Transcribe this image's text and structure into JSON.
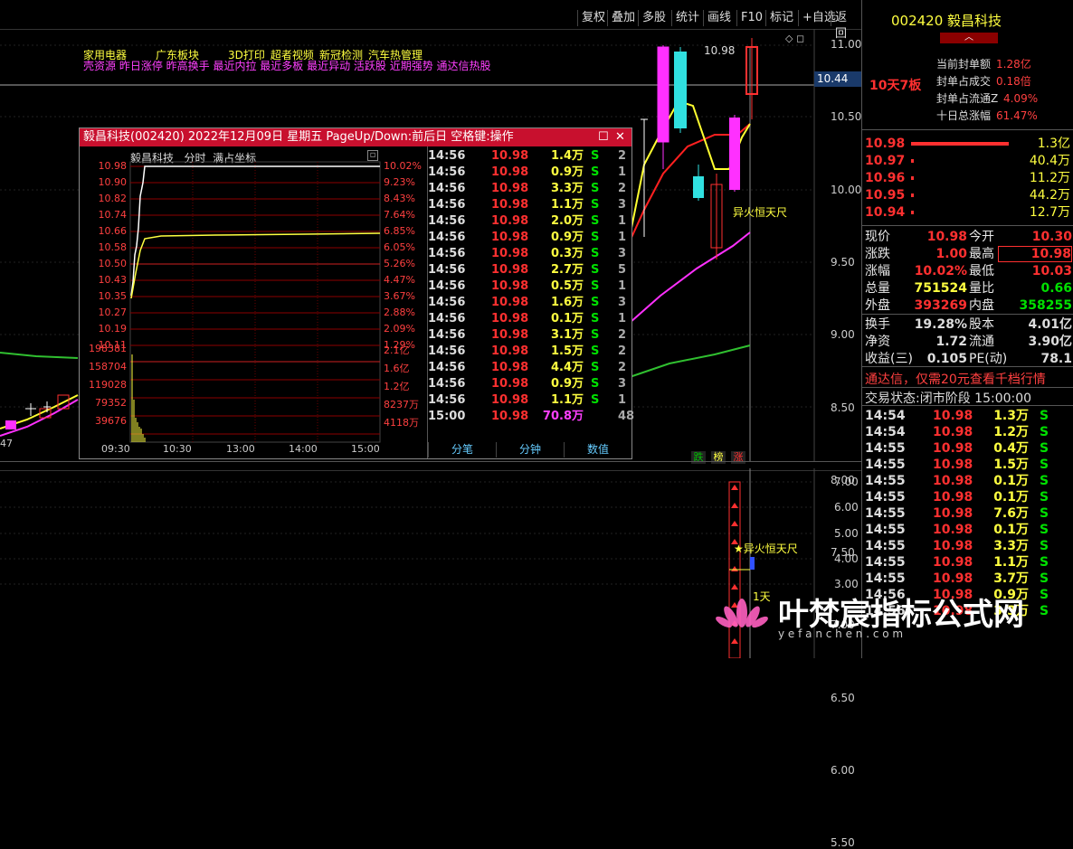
{
  "toolbar": {
    "buttons": [
      "复权",
      "叠加",
      "多股",
      "统计",
      "画线",
      "F10",
      "标记",
      "+自选",
      "返回"
    ]
  },
  "main_chart": {
    "concept_tags_1": [
      "家用电器",
      "广东板块",
      "3D打印",
      "超者视频",
      "新冠检测",
      "汽车热管理"
    ],
    "concept_tags_2": "壳资源 昨日涨停 昨高换手 最近内拉 最近多板 最近异动 活跃股 近期强势 通达信热股",
    "price_axis": [
      "11.00",
      "10.50",
      "10.00",
      "9.50",
      "9.00",
      "8.50",
      "8.00",
      "7.50",
      "7.00",
      "6.50",
      "6.00",
      "5.50"
    ],
    "current_price_label": "10.44",
    "high_label": "10.98",
    "annotation": "异火恒天尺",
    "left_label": "47",
    "bottom_badges": [
      "跌",
      "榜",
      "涨"
    ]
  },
  "indicator": {
    "axis": [
      "7.00",
      "6.00",
      "5.00",
      "4.00",
      "3.00"
    ],
    "annotation": "★异火恒天尺",
    "day_label": "1天"
  },
  "popup": {
    "title": "毅昌科技(002420) 2022年12月09日 星期五 PageUp/Down:前后日 空格键:操作",
    "sub_name": "毅昌科技",
    "sub_mode": "分时",
    "sub_scale": "满占坐标",
    "price_left": [
      "10.98",
      "10.90",
      "10.82",
      "10.74",
      "10.66",
      "10.58",
      "10.50",
      "10.43",
      "10.35",
      "10.27",
      "10.19",
      "10.11"
    ],
    "pct_right": [
      "10.02%",
      "9.23%",
      "8.43%",
      "7.64%",
      "6.85%",
      "6.05%",
      "5.26%",
      "4.47%",
      "3.67%",
      "2.88%",
      "2.09%",
      "1.29%"
    ],
    "vol_left": [
      "198381",
      "158704",
      "119028",
      "79352",
      "39676"
    ],
    "vol_right": [
      "2.1亿",
      "1.6亿",
      "1.2亿",
      "8237万",
      "4118万"
    ],
    "time_axis": [
      "09:30",
      "10:30",
      "13:00",
      "14:00",
      "15:00"
    ],
    "ticks": [
      {
        "t": "14:56",
        "p": "10.98",
        "v": "1.4万",
        "s": "S",
        "n": "2"
      },
      {
        "t": "14:56",
        "p": "10.98",
        "v": "0.9万",
        "s": "S",
        "n": "1"
      },
      {
        "t": "14:56",
        "p": "10.98",
        "v": "3.3万",
        "s": "S",
        "n": "2"
      },
      {
        "t": "14:56",
        "p": "10.98",
        "v": "1.1万",
        "s": "S",
        "n": "3"
      },
      {
        "t": "14:56",
        "p": "10.98",
        "v": "2.0万",
        "s": "S",
        "n": "1"
      },
      {
        "t": "14:56",
        "p": "10.98",
        "v": "0.9万",
        "s": "S",
        "n": "1"
      },
      {
        "t": "14:56",
        "p": "10.98",
        "v": "0.3万",
        "s": "S",
        "n": "3"
      },
      {
        "t": "14:56",
        "p": "10.98",
        "v": "2.7万",
        "s": "S",
        "n": "5"
      },
      {
        "t": "14:56",
        "p": "10.98",
        "v": "0.5万",
        "s": "S",
        "n": "1"
      },
      {
        "t": "14:56",
        "p": "10.98",
        "v": "1.6万",
        "s": "S",
        "n": "3"
      },
      {
        "t": "14:56",
        "p": "10.98",
        "v": "0.1万",
        "s": "S",
        "n": "1"
      },
      {
        "t": "14:56",
        "p": "10.98",
        "v": "3.1万",
        "s": "S",
        "n": "2"
      },
      {
        "t": "14:56",
        "p": "10.98",
        "v": "1.5万",
        "s": "S",
        "n": "2"
      },
      {
        "t": "14:56",
        "p": "10.98",
        "v": "4.4万",
        "s": "S",
        "n": "2"
      },
      {
        "t": "14:56",
        "p": "10.98",
        "v": "0.9万",
        "s": "S",
        "n": "3"
      },
      {
        "t": "14:56",
        "p": "10.98",
        "v": "1.1万",
        "s": "S",
        "n": "1"
      },
      {
        "t": "15:00",
        "p": "10.98",
        "v": "70.8万",
        "s": "",
        "n": "48"
      }
    ],
    "tabs": [
      "分笔",
      "分钟",
      "数值"
    ]
  },
  "right_panel": {
    "code": "002420",
    "name": "毅昌科技",
    "streak": "10天7板",
    "seal_stats": [
      {
        "label": "当前封单额",
        "value": "1.28亿"
      },
      {
        "label": "封单占成交",
        "value": "0.18倍"
      },
      {
        "label": "封单占流通Z",
        "value": "4.09%"
      },
      {
        "label": "十日总涨幅",
        "value": "61.47%"
      }
    ],
    "order_book": [
      {
        "price": "10.98",
        "vol": "1.3亿"
      },
      {
        "price": "10.97",
        "vol": "40.4万"
      },
      {
        "price": "10.96",
        "vol": "11.2万"
      },
      {
        "price": "10.95",
        "vol": "44.2万"
      },
      {
        "price": "10.94",
        "vol": "12.7万"
      }
    ],
    "quote": [
      {
        "l1": "现价",
        "v1": "10.98",
        "l2": "今开",
        "v2": "10.30"
      },
      {
        "l1": "涨跌",
        "v1": "1.00",
        "l2": "最高",
        "v2": "10.98"
      },
      {
        "l1": "涨幅",
        "v1": "10.02%",
        "l2": "最低",
        "v2": "10.03"
      },
      {
        "l1": "总量",
        "v1": "751524",
        "l2": "量比",
        "v2": "0.66"
      },
      {
        "l1": "外盘",
        "v1": "393269",
        "l2": "内盘",
        "v2": "358255"
      },
      {
        "l1": "换手",
        "v1": "19.28%",
        "l2": "股本",
        "v2": "4.01亿"
      },
      {
        "l1": "净资",
        "v1": "1.72",
        "l2": "流通",
        "v2": "3.90亿"
      },
      {
        "l1": "收益(三)",
        "v1": "0.105",
        "l2": "PE(动)",
        "v2": "78.1"
      }
    ],
    "promo": "通达信，仅需20元查看千档行情",
    "status_label": "交易状态:",
    "status_value": "闭市阶段 15:00:00",
    "trades": [
      {
        "t": "14:54",
        "p": "10.98",
        "v": "1.3万",
        "s": "S"
      },
      {
        "t": "14:54",
        "p": "10.98",
        "v": "1.2万",
        "s": "S"
      },
      {
        "t": "14:55",
        "p": "10.98",
        "v": "0.4万",
        "s": "S"
      },
      {
        "t": "14:55",
        "p": "10.98",
        "v": "1.5万",
        "s": "S"
      },
      {
        "t": "14:55",
        "p": "10.98",
        "v": "0.1万",
        "s": "S"
      },
      {
        "t": "14:55",
        "p": "10.98",
        "v": "0.1万",
        "s": "S"
      },
      {
        "t": "14:55",
        "p": "10.98",
        "v": "7.6万",
        "s": "S"
      },
      {
        "t": "14:55",
        "p": "10.98",
        "v": "0.1万",
        "s": "S"
      },
      {
        "t": "14:55",
        "p": "10.98",
        "v": "3.3万",
        "s": "S"
      },
      {
        "t": "14:55",
        "p": "10.98",
        "v": "1.1万",
        "s": "S"
      },
      {
        "t": "14:55",
        "p": "10.98",
        "v": "3.7万",
        "s": "S"
      },
      {
        "t": "14:56",
        "p": "10.98",
        "v": "0.9万",
        "s": "S"
      },
      {
        "t": "14:56",
        "p": "10.98",
        "v": "3.3万",
        "s": "S"
      }
    ]
  },
  "watermark": {
    "title": "叶梵宸指标公式网",
    "url": "y e f a n c h e n . c o m"
  }
}
